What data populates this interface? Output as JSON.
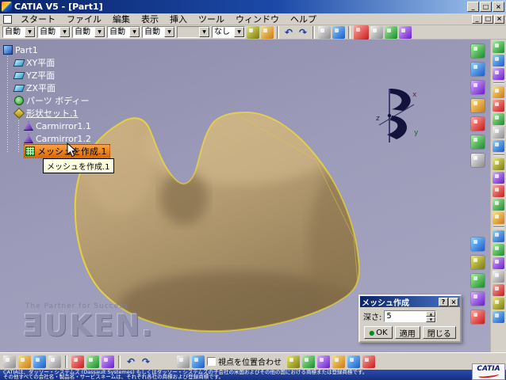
{
  "window": {
    "title": "CATIA V5 - [Part1]"
  },
  "icons": {
    "minimize": "_",
    "maximize": "□",
    "close": "×",
    "combo_arrow": "▼",
    "dialog_help": "?",
    "dialog_close": "×",
    "spin_up": "▲",
    "spin_down": "▼",
    "ok_dot": "●",
    "undo": "↶",
    "redo": "↷"
  },
  "menubar": {
    "items": [
      "スタート",
      "ファイル",
      "編集",
      "表示",
      "挿入",
      "ツール",
      "ウィンドウ",
      "ヘルプ"
    ]
  },
  "toolbar": {
    "combos": [
      "自動",
      "自動",
      "自動",
      "自動",
      "自動",
      "",
      "なし"
    ]
  },
  "tree": {
    "root": "Part1",
    "plane_xy": "XY平面",
    "plane_yz": "YZ平面",
    "plane_zx": "ZX平面",
    "body": "パーツ ボディー",
    "geoset": "形状セット.1",
    "child1": "Carmirror1.1",
    "child2": "Carmirror1.2",
    "selected": "メッシュを作成.1"
  },
  "tooltip": {
    "text": "メッシュを作成.1"
  },
  "viewport": {
    "watermark_tagline": "The Partner for Success",
    "watermark_logo": "ƎUKEN.",
    "compass": {
      "x": "x",
      "y": "y",
      "z": "z"
    }
  },
  "dialog": {
    "title": "メッシュ作成",
    "depth_label": "深さ:",
    "depth_value": "5",
    "ok": "OK",
    "apply": "適用",
    "close": "閉じる"
  },
  "bottom": {
    "checkbox_label": "視点を位置合わせ"
  },
  "statusbar": {
    "line1": "CATIAは、ダッソー・システムズ (Dassault Systemes) もしくはダッソー・システムズの子会社の米国およびその他の国における商標または登録商標です。",
    "line2": "その他すべての会社名・製品名・サービスネームは、それぞれ各社の商標および登録商標です。"
  },
  "brand": {
    "name": "CATIA"
  },
  "colors": {
    "accent_orange": "#e87a10",
    "viewport_bg": "#9a9ab8",
    "shape_fill": "#b39a70",
    "shape_outline": "#e8d84a",
    "title_blue": "#0a246a"
  }
}
